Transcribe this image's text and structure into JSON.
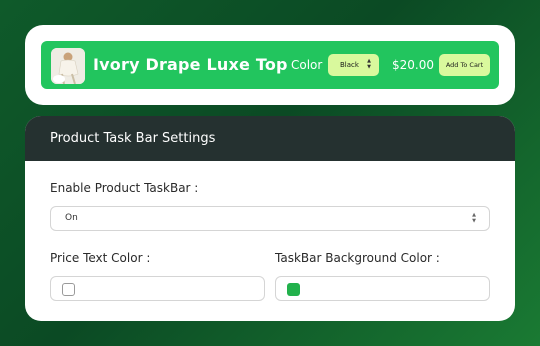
{
  "preview": {
    "product_title": "Ivory Drape Luxe Top",
    "color_label": "Color",
    "color_value": "Black",
    "price": "$20.00",
    "add_to_cart_label": "Add To Cart",
    "taskbar_color": "#22c55e",
    "button_color": "#d9f99d"
  },
  "settings": {
    "title": "Product Task Bar Settings",
    "enable_label": "Enable Product TaskBar :",
    "enable_value": "On",
    "price_text_color_label": "Price Text Color :",
    "price_text_color": "#ffffff",
    "taskbar_bg_color_label": "TaskBar Background Color :",
    "taskbar_bg_color": "#22b14c"
  }
}
